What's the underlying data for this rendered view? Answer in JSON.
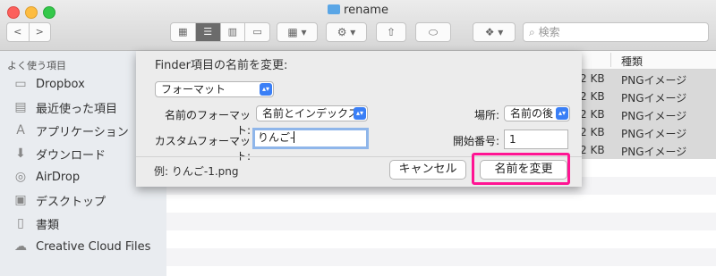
{
  "window": {
    "title": "rename"
  },
  "toolbar": {
    "back": "<",
    "forward": ">",
    "search_placeholder": "検索"
  },
  "sidebar": {
    "header": "よく使う項目",
    "items": [
      {
        "label": "Dropbox",
        "icon": "folder-icon"
      },
      {
        "label": "最近使った項目",
        "icon": "recent-icon"
      },
      {
        "label": "アプリケーション",
        "icon": "apps-icon"
      },
      {
        "label": "ダウンロード",
        "icon": "download-icon"
      },
      {
        "label": "AirDrop",
        "icon": "airdrop-icon"
      },
      {
        "label": "デスクトップ",
        "icon": "desktop-icon"
      },
      {
        "label": "書類",
        "icon": "documents-icon"
      },
      {
        "label": "Creative Cloud Files",
        "icon": "creative-cloud-icon"
      }
    ]
  },
  "list": {
    "col_kind": "種類",
    "rows": [
      {
        "size": "2 KB",
        "kind": "PNGイメージ"
      },
      {
        "size": "2 KB",
        "kind": "PNGイメージ"
      },
      {
        "size": "2 KB",
        "kind": "PNGイメージ"
      },
      {
        "size": "2 KB",
        "kind": "PNGイメージ"
      },
      {
        "size": "2 KB",
        "kind": "PNGイメージ"
      }
    ]
  },
  "sheet": {
    "title": "Finder項目の名前を変更:",
    "mode_value": "フォーマット",
    "name_format_label": "名前のフォーマット:",
    "name_format_value": "名前とインデックス",
    "location_label": "場所:",
    "location_value": "名前の後",
    "custom_format_label": "カスタムフォーマット:",
    "custom_format_value": "りんご-",
    "start_number_label": "開始番号:",
    "start_number_value": "1",
    "example": "例: りんご-1.png",
    "cancel": "キャンセル",
    "rename": "名前を変更"
  },
  "colors": {
    "highlight": "#ff1493",
    "accent": "#3a7ff6"
  }
}
